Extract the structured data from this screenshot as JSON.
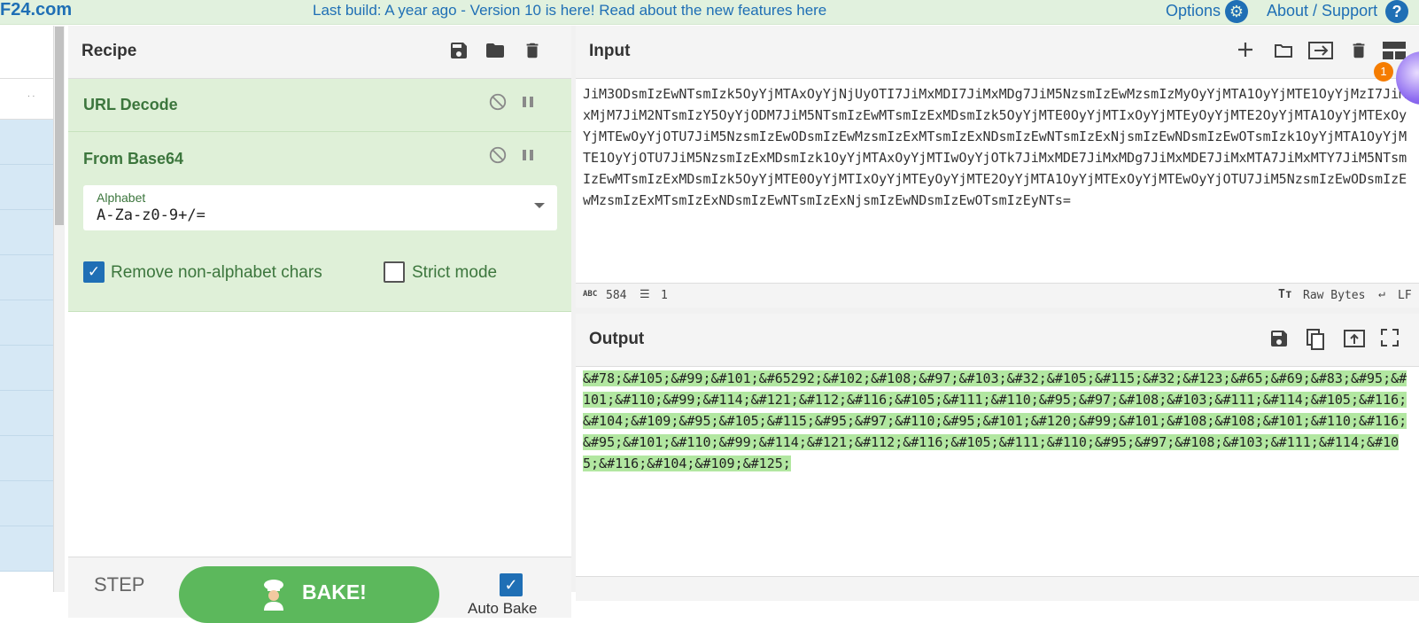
{
  "topbar": {
    "logo": "F24.com",
    "banner": "Last build: A year ago - Version 10 is here! Read about the new features here",
    "options": "Options",
    "about": "About / Support"
  },
  "ops_sidebar": {
    "search_hint": ". ."
  },
  "recipe": {
    "title": "Recipe",
    "operations": [
      {
        "name": "URL Decode"
      },
      {
        "name": "From Base64",
        "alphabet_label": "Alphabet",
        "alphabet_value": "A-Za-z0-9+/=",
        "remove_non_alpha_label": "Remove non-alphabet chars",
        "remove_non_alpha_checked": true,
        "strict_mode_label": "Strict mode",
        "strict_mode_checked": false
      }
    ],
    "step_label": "STEP",
    "bake_label": "BAKE!",
    "autobake_label": "Auto Bake",
    "autobake_checked": true
  },
  "input": {
    "title": "Input",
    "text": "JiM3ODsmIzEwNTsmIzk5OyYjMTAxOyYjNjUyOTI7JiMxMDI7JiMxMDg7JiM5NzsmIzEwMzsmIzMyOyYjMTA1OyYjMTE1OyYjMzI7JiMxMjM7JiM2NTsmIzY5OyYjODM7JiM5NTsmIzEwMTsmIzExMDsmIzk5OyYjMTE0OyYjMTIxOyYjMTEyOyYjMTE2OyYjMTA1OyYjMTExOyYjMTEwOyYjOTU7JiM5NzsmIzEwODsmIzEwMzsmIzExMTsmIzExNDsmIzEwNTsmIzExNjsmIzEwNDsmIzEwOTsmIzk1OyYjMTA1OyYjMTE1OyYjOTU7JiM5NzsmIzExMDsmIzk1OyYjMTAxOyYjMTIwOyYjOTk7JiMxMDE7JiMxMDg7JiMxMDE7JiMxMTA7JiMxMTY7JiM5NTsmIzEwMTsmIzExMDsmIzk5OyYjMTE0OyYjMTIxOyYjMTEyOyYjMTE2OyYjMTA1OyYjMTExOyYjMTEwOyYjOTU7JiM5NzsmIzEwODsmIzEwMzsmIzExMTsmIzExNDsmIzEwNTsmIzExNjsmIzEwNDsmIzEwOTsmIzEyNTs=",
    "char_count": "584",
    "line_count": "1",
    "encoding": "Raw Bytes",
    "eol": "LF"
  },
  "output": {
    "title": "Output",
    "text": "&#78;&#105;&#99;&#101;&#65292;&#102;&#108;&#97;&#103;&#32;&#105;&#115;&#32;&#123;&#65;&#69;&#83;&#95;&#101;&#110;&#99;&#114;&#121;&#112;&#116;&#105;&#111;&#110;&#95;&#97;&#108;&#103;&#111;&#114;&#105;&#116;&#104;&#109;&#95;&#105;&#115;&#95;&#97;&#110;&#95;&#101;&#120;&#99;&#101;&#108;&#108;&#101;&#110;&#116;&#95;&#101;&#110;&#99;&#114;&#121;&#112;&#116;&#105;&#111;&#110;&#95;&#97;&#108;&#103;&#111;&#114;&#105;&#116;&#104;&#109;&#125;"
  },
  "notification": {
    "count": "1"
  },
  "icons": {
    "save": "save-icon",
    "open": "folder-icon",
    "delete": "trash-icon",
    "disable": "disable-icon",
    "pause": "pause-icon",
    "add": "plus-icon",
    "input_to_output": "input-arrow-icon",
    "layout": "layout-icon",
    "copy": "copy-icon",
    "output_to_input": "replace-input-icon",
    "maximise": "maximise-icon"
  },
  "colors": {
    "accent": "#1f6fb5",
    "op_bg": "#dff0d8",
    "op_text": "#3c763d",
    "bake": "#5cb85c",
    "highlight": "#b2e7a1"
  }
}
